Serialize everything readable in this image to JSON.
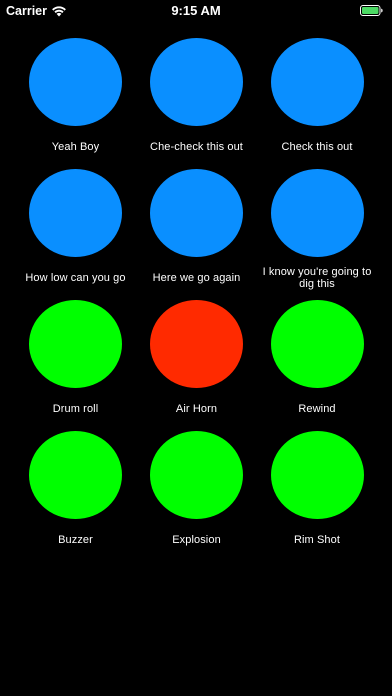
{
  "status_bar": {
    "carrier": "Carrier",
    "time": "9:15 AM",
    "icons": [
      "wifi-icon",
      "battery-icon"
    ],
    "battery_color": "#4cd964",
    "battery_level": 1.0
  },
  "colors": {
    "background": "#000000",
    "blue": "#0a8fff",
    "green": "#00ff00",
    "red": "#ff2a00",
    "label": "#ffffff"
  },
  "sounds": [
    {
      "label": "Yeah Boy",
      "color": "#0a8fff"
    },
    {
      "label": "Che-check this out",
      "color": "#0a8fff"
    },
    {
      "label": "Check this out",
      "color": "#0a8fff"
    },
    {
      "label": "How low can you go",
      "color": "#0a8fff"
    },
    {
      "label": "Here we go again",
      "color": "#0a8fff"
    },
    {
      "label": "I know you're going to dig this",
      "color": "#0a8fff"
    },
    {
      "label": "Drum roll",
      "color": "#00ff00"
    },
    {
      "label": "Air Horn",
      "color": "#ff2a00"
    },
    {
      "label": "Rewind",
      "color": "#00ff00"
    },
    {
      "label": "Buzzer",
      "color": "#00ff00"
    },
    {
      "label": "Explosion",
      "color": "#00ff00"
    },
    {
      "label": "Rim Shot",
      "color": "#00ff00"
    }
  ]
}
